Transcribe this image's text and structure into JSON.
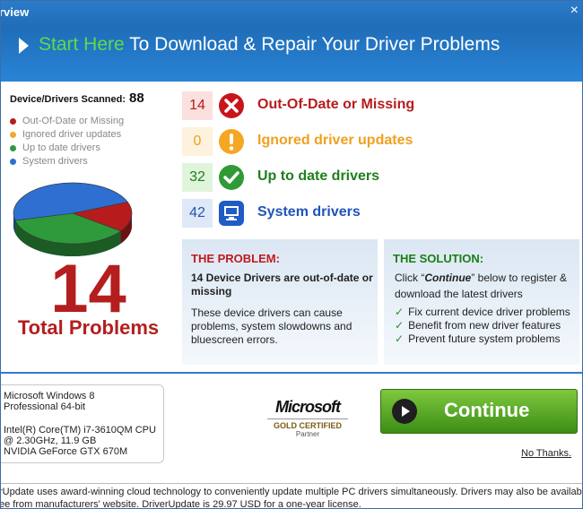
{
  "window": {
    "title": "rview",
    "close_glyph": "×"
  },
  "header": {
    "headline_green": "Start Here",
    "headline_rest": " To Download & Repair Your Driver Problems"
  },
  "scan": {
    "label": "Device/Drivers Scanned:",
    "count": "88"
  },
  "legend": [
    {
      "label": "Out-Of-Date or Missing",
      "color": "#b71c1c"
    },
    {
      "label": "Ignored driver updates",
      "color": "#f0a830"
    },
    {
      "label": "Up to date drivers",
      "color": "#2e9a3c"
    },
    {
      "label": "System drivers",
      "color": "#2e6fd1"
    }
  ],
  "pie": {
    "values": [
      14,
      0,
      32,
      42
    ],
    "colors": [
      "#b71c1c",
      "#f0a830",
      "#2e9a3c",
      "#2e6fd1"
    ]
  },
  "totals": {
    "number": "14",
    "label": "Total Problems"
  },
  "stats": [
    {
      "count": "14",
      "label": "Out-Of-Date or Missing",
      "color": "#b71c1c",
      "bg": "#fbe0e0",
      "icon": "x-icon"
    },
    {
      "count": "0",
      "label": "Ignored driver updates",
      "color": "#f0a020",
      "bg": "#fdf2dd",
      "icon": "warning-icon"
    },
    {
      "count": "32",
      "label": "Up to date drivers",
      "color": "#1e7f1e",
      "bg": "#e0f4dc",
      "icon": "check-icon"
    },
    {
      "count": "42",
      "label": "System drivers",
      "color": "#1f55b8",
      "bg": "#dfe8f7",
      "icon": "monitor-icon"
    }
  ],
  "problem": {
    "heading": "THE PROBLEM:",
    "bold_text": "14 Device Drivers are out-of-date or missing",
    "text": "These device drivers can cause problems, system slowdowns and bluescreen errors."
  },
  "solution": {
    "heading": "THE SOLUTION:",
    "text_before": "Click “",
    "text_bold": "Continue",
    "text_after": "” below to register & download the latest drivers",
    "checks": [
      "Fix current device driver problems",
      "Benefit from new driver features",
      "Prevent future system problems"
    ]
  },
  "system": {
    "os_line1": "Microsoft Windows 8",
    "os_line2": "Professional 64-bit",
    "cpu_line1": "Intel(R) Core(TM) i7-3610QM CPU",
    "cpu_line2": "@ 2.30GHz, 11.9 GB",
    "gpu": "NVIDIA GeForce GTX 670M"
  },
  "badge": {
    "logo": "Microsoft",
    "cert": "GOLD CERTIFIED",
    "partner": "Partner"
  },
  "actions": {
    "continue": "Continue",
    "no_thanks": "No Thanks."
  },
  "footer": {
    "line1": "rUpdate uses award-winning cloud technology to conveniently update multiple PC drivers simultaneously. Drivers may also be available",
    "line2": "ee from manufacturers' website. DriverUpdate is 29.97 USD for a one-year license."
  }
}
